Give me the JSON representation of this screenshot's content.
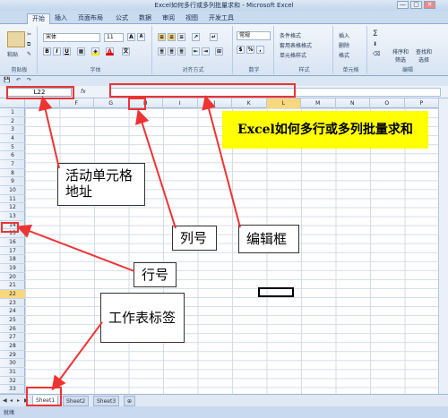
{
  "window": {
    "title": "Excel如何多行或多列批量求和 - Microsoft Excel",
    "min": "—",
    "max": "▢",
    "close": "✕"
  },
  "ribbon_tabs": [
    "开始",
    "插入",
    "页面布局",
    "公式",
    "数据",
    "审阅",
    "视图",
    "开发工具"
  ],
  "ribbon": {
    "clipboard": {
      "paste": "粘贴",
      "label": "剪贴板"
    },
    "font": {
      "name": "宋体",
      "size": "11",
      "label": "字体",
      "bold": "B",
      "italic": "I",
      "underline": "U",
      "grow": "A",
      "shrink": "A",
      "wen": "文"
    },
    "alignment": {
      "label": "对齐方式"
    },
    "number": {
      "format": "常规",
      "percent": "%",
      "comma": ",",
      "label": "数字"
    },
    "styles": {
      "cond": "条件格式",
      "table": "套用表格格式",
      "cell": "单元格样式",
      "label": "样式"
    },
    "cells": {
      "insert": "插入",
      "delete": "删除",
      "format": "格式",
      "label": "单元格"
    },
    "editing": {
      "sigma": "Σ",
      "sort": "排序和\n筛选",
      "find": "查找和\n选择",
      "label": "编辑"
    }
  },
  "formula_bar": {
    "namebox": "L22",
    "fx": "fx",
    "value": ""
  },
  "columns": [
    "E",
    "F",
    "G",
    "H",
    "I",
    "J",
    "K",
    "L",
    "M",
    "N",
    "O",
    "P"
  ],
  "selected_column": "L",
  "rows": [
    "1",
    "2",
    "3",
    "4",
    "5",
    "6",
    "7",
    "8",
    "9",
    "10",
    "11",
    "12",
    "13",
    "14",
    "15",
    "16",
    "17",
    "18",
    "19",
    "20",
    "21",
    "22",
    "23",
    "24",
    "25",
    "26",
    "27",
    "28",
    "29",
    "30",
    "31",
    "32",
    "33"
  ],
  "selected_row": "22",
  "sheets": [
    "Sheet1",
    "Sheet2",
    "Sheet3"
  ],
  "active_sheet": "Sheet1",
  "status": "就绪",
  "banner": "Excel如何多行或多列批量求和",
  "callouts": {
    "namebox": "活动单元格\n地址",
    "column": "列号",
    "editbox": "编辑框",
    "row": "行号",
    "sheettab": "工作表标签"
  },
  "colors": {
    "annotation": "#e33333",
    "banner": "#ffff00",
    "header_selected": "#f8d77e"
  }
}
